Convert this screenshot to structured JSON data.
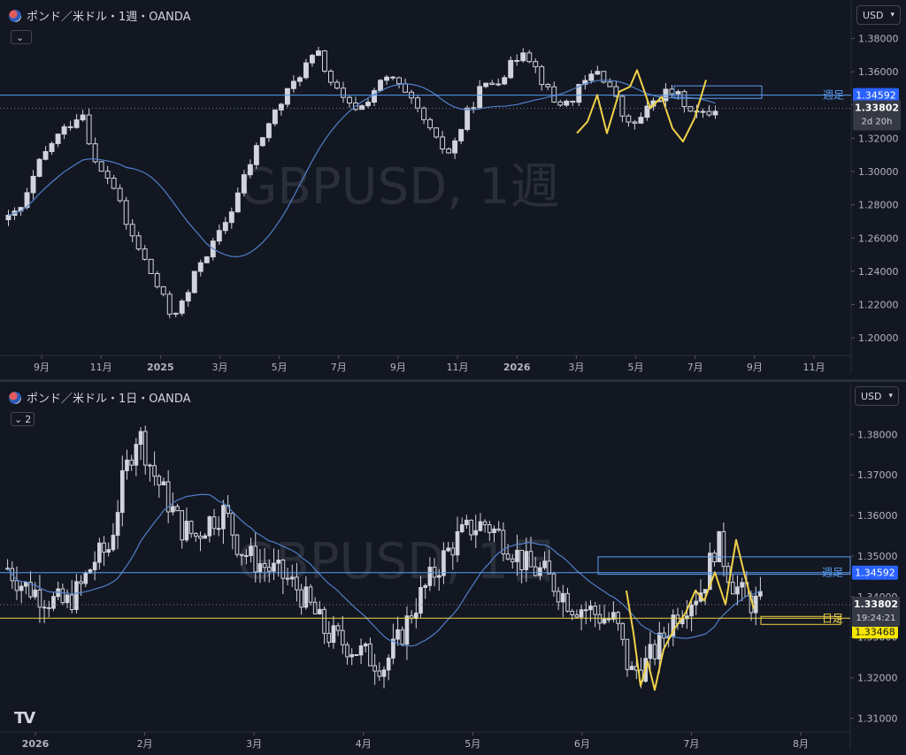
{
  "chart_data": [
    {
      "type": "candlestick",
      "title": "ポンド／米ドル・1週・OANDA",
      "watermark": "GBPUSD, 1週",
      "currency": "USD",
      "collapse_label": "",
      "x_ticks": [
        "9月",
        "11月",
        "2025",
        "3月",
        "5月",
        "7月",
        "9月",
        "11月",
        "2026",
        "3月",
        "5月",
        "7月",
        "9月",
        "11月"
      ],
      "y_ticks": [
        "1.38000",
        "1.36000",
        "1.34000",
        "1.32000",
        "1.30000",
        "1.28000",
        "1.26000",
        "1.24000",
        "1.22000",
        "1.20000"
      ],
      "ylim": [
        1.1905,
        1.3925
      ],
      "level_line": {
        "label": "週足",
        "value": 1.34592,
        "value_label": "1.34592"
      },
      "last_price": {
        "value": 1.33802,
        "value_label": "1.33802",
        "countdown": "2d 20h"
      },
      "moving_average": true,
      "grid": false,
      "candle_color": "#d1d4dc",
      "level_color": "#5b9bf1",
      "drawing_color": "#f0d24a",
      "close_series_sample": [
        1.271,
        1.279,
        1.303,
        1.318,
        1.327,
        1.337,
        1.301,
        1.295,
        1.268,
        1.251,
        1.233,
        1.214,
        1.222,
        1.246,
        1.257,
        1.274,
        1.296,
        1.317,
        1.334,
        1.348,
        1.362,
        1.371,
        1.352,
        1.339,
        1.339,
        1.351,
        1.357,
        1.345,
        1.334,
        1.318,
        1.311,
        1.332,
        1.349,
        1.354,
        1.362,
        1.375,
        1.359,
        1.342,
        1.341,
        1.352,
        1.361,
        1.349,
        1.327,
        1.332,
        1.345,
        1.348,
        1.341,
        1.333,
        1.338
      ]
    },
    {
      "type": "candlestick",
      "title": "ポンド／米ドル・1日・OANDA",
      "watermark": "GBPUSD, 1日",
      "currency": "USD",
      "collapse_label": "2",
      "x_ticks": [
        "2026",
        "2月",
        "3月",
        "4月",
        "5月",
        "6月",
        "7月",
        "8月"
      ],
      "y_ticks": [
        "1.38000",
        "1.37000",
        "1.36000",
        "1.35000",
        "1.34000",
        "1.33000",
        "1.32000",
        "1.31000"
      ],
      "ylim": [
        1.3075,
        1.389
      ],
      "level_line": {
        "label": "週足",
        "value": 1.34592,
        "value_label": "1.34592"
      },
      "level_line_2": {
        "label": "日足",
        "value": 1.33468,
        "value_label": "1.33468"
      },
      "last_price": {
        "value": 1.33802,
        "value_label": "1.33802",
        "countdown": "19:24:21"
      },
      "moving_average": true,
      "grid": false,
      "candle_color": "#d1d4dc",
      "level_color": "#5b9bf1",
      "drawing_color": "#f0d24a",
      "close_series_sample": [
        1.347,
        1.343,
        1.341,
        1.339,
        1.338,
        1.342,
        1.349,
        1.352,
        1.369,
        1.381,
        1.371,
        1.364,
        1.357,
        1.355,
        1.359,
        1.361,
        1.352,
        1.349,
        1.347,
        1.345,
        1.342,
        1.337,
        1.331,
        1.329,
        1.327,
        1.325,
        1.323,
        1.329,
        1.337,
        1.343,
        1.349,
        1.354,
        1.357,
        1.358,
        1.355,
        1.351,
        1.347,
        1.346,
        1.342,
        1.338,
        1.337,
        1.335,
        1.334,
        1.321,
        1.323,
        1.328,
        1.335,
        1.339,
        1.342,
        1.354,
        1.344,
        1.339,
        1.338
      ]
    }
  ],
  "brand": {
    "logo_text": "TV"
  }
}
